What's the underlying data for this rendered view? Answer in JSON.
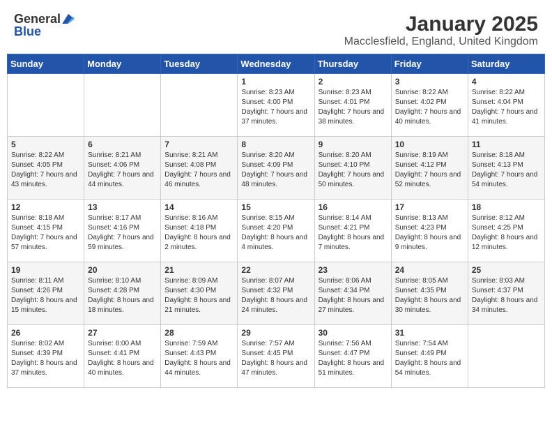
{
  "header": {
    "logo_general": "General",
    "logo_blue": "Blue",
    "month": "January 2025",
    "location": "Macclesfield, England, United Kingdom"
  },
  "weekdays": [
    "Sunday",
    "Monday",
    "Tuesday",
    "Wednesday",
    "Thursday",
    "Friday",
    "Saturday"
  ],
  "weeks": [
    [
      {
        "day": "",
        "info": ""
      },
      {
        "day": "",
        "info": ""
      },
      {
        "day": "",
        "info": ""
      },
      {
        "day": "1",
        "info": "Sunrise: 8:23 AM\nSunset: 4:00 PM\nDaylight: 7 hours and 37 minutes."
      },
      {
        "day": "2",
        "info": "Sunrise: 8:23 AM\nSunset: 4:01 PM\nDaylight: 7 hours and 38 minutes."
      },
      {
        "day": "3",
        "info": "Sunrise: 8:22 AM\nSunset: 4:02 PM\nDaylight: 7 hours and 40 minutes."
      },
      {
        "day": "4",
        "info": "Sunrise: 8:22 AM\nSunset: 4:04 PM\nDaylight: 7 hours and 41 minutes."
      }
    ],
    [
      {
        "day": "5",
        "info": "Sunrise: 8:22 AM\nSunset: 4:05 PM\nDaylight: 7 hours and 43 minutes."
      },
      {
        "day": "6",
        "info": "Sunrise: 8:21 AM\nSunset: 4:06 PM\nDaylight: 7 hours and 44 minutes."
      },
      {
        "day": "7",
        "info": "Sunrise: 8:21 AM\nSunset: 4:08 PM\nDaylight: 7 hours and 46 minutes."
      },
      {
        "day": "8",
        "info": "Sunrise: 8:20 AM\nSunset: 4:09 PM\nDaylight: 7 hours and 48 minutes."
      },
      {
        "day": "9",
        "info": "Sunrise: 8:20 AM\nSunset: 4:10 PM\nDaylight: 7 hours and 50 minutes."
      },
      {
        "day": "10",
        "info": "Sunrise: 8:19 AM\nSunset: 4:12 PM\nDaylight: 7 hours and 52 minutes."
      },
      {
        "day": "11",
        "info": "Sunrise: 8:18 AM\nSunset: 4:13 PM\nDaylight: 7 hours and 54 minutes."
      }
    ],
    [
      {
        "day": "12",
        "info": "Sunrise: 8:18 AM\nSunset: 4:15 PM\nDaylight: 7 hours and 57 minutes."
      },
      {
        "day": "13",
        "info": "Sunrise: 8:17 AM\nSunset: 4:16 PM\nDaylight: 7 hours and 59 minutes."
      },
      {
        "day": "14",
        "info": "Sunrise: 8:16 AM\nSunset: 4:18 PM\nDaylight: 8 hours and 2 minutes."
      },
      {
        "day": "15",
        "info": "Sunrise: 8:15 AM\nSunset: 4:20 PM\nDaylight: 8 hours and 4 minutes."
      },
      {
        "day": "16",
        "info": "Sunrise: 8:14 AM\nSunset: 4:21 PM\nDaylight: 8 hours and 7 minutes."
      },
      {
        "day": "17",
        "info": "Sunrise: 8:13 AM\nSunset: 4:23 PM\nDaylight: 8 hours and 9 minutes."
      },
      {
        "day": "18",
        "info": "Sunrise: 8:12 AM\nSunset: 4:25 PM\nDaylight: 8 hours and 12 minutes."
      }
    ],
    [
      {
        "day": "19",
        "info": "Sunrise: 8:11 AM\nSunset: 4:26 PM\nDaylight: 8 hours and 15 minutes."
      },
      {
        "day": "20",
        "info": "Sunrise: 8:10 AM\nSunset: 4:28 PM\nDaylight: 8 hours and 18 minutes."
      },
      {
        "day": "21",
        "info": "Sunrise: 8:09 AM\nSunset: 4:30 PM\nDaylight: 8 hours and 21 minutes."
      },
      {
        "day": "22",
        "info": "Sunrise: 8:07 AM\nSunset: 4:32 PM\nDaylight: 8 hours and 24 minutes."
      },
      {
        "day": "23",
        "info": "Sunrise: 8:06 AM\nSunset: 4:34 PM\nDaylight: 8 hours and 27 minutes."
      },
      {
        "day": "24",
        "info": "Sunrise: 8:05 AM\nSunset: 4:35 PM\nDaylight: 8 hours and 30 minutes."
      },
      {
        "day": "25",
        "info": "Sunrise: 8:03 AM\nSunset: 4:37 PM\nDaylight: 8 hours and 34 minutes."
      }
    ],
    [
      {
        "day": "26",
        "info": "Sunrise: 8:02 AM\nSunset: 4:39 PM\nDaylight: 8 hours and 37 minutes."
      },
      {
        "day": "27",
        "info": "Sunrise: 8:00 AM\nSunset: 4:41 PM\nDaylight: 8 hours and 40 minutes."
      },
      {
        "day": "28",
        "info": "Sunrise: 7:59 AM\nSunset: 4:43 PM\nDaylight: 8 hours and 44 minutes."
      },
      {
        "day": "29",
        "info": "Sunrise: 7:57 AM\nSunset: 4:45 PM\nDaylight: 8 hours and 47 minutes."
      },
      {
        "day": "30",
        "info": "Sunrise: 7:56 AM\nSunset: 4:47 PM\nDaylight: 8 hours and 51 minutes."
      },
      {
        "day": "31",
        "info": "Sunrise: 7:54 AM\nSunset: 4:49 PM\nDaylight: 8 hours and 54 minutes."
      },
      {
        "day": "",
        "info": ""
      }
    ]
  ]
}
